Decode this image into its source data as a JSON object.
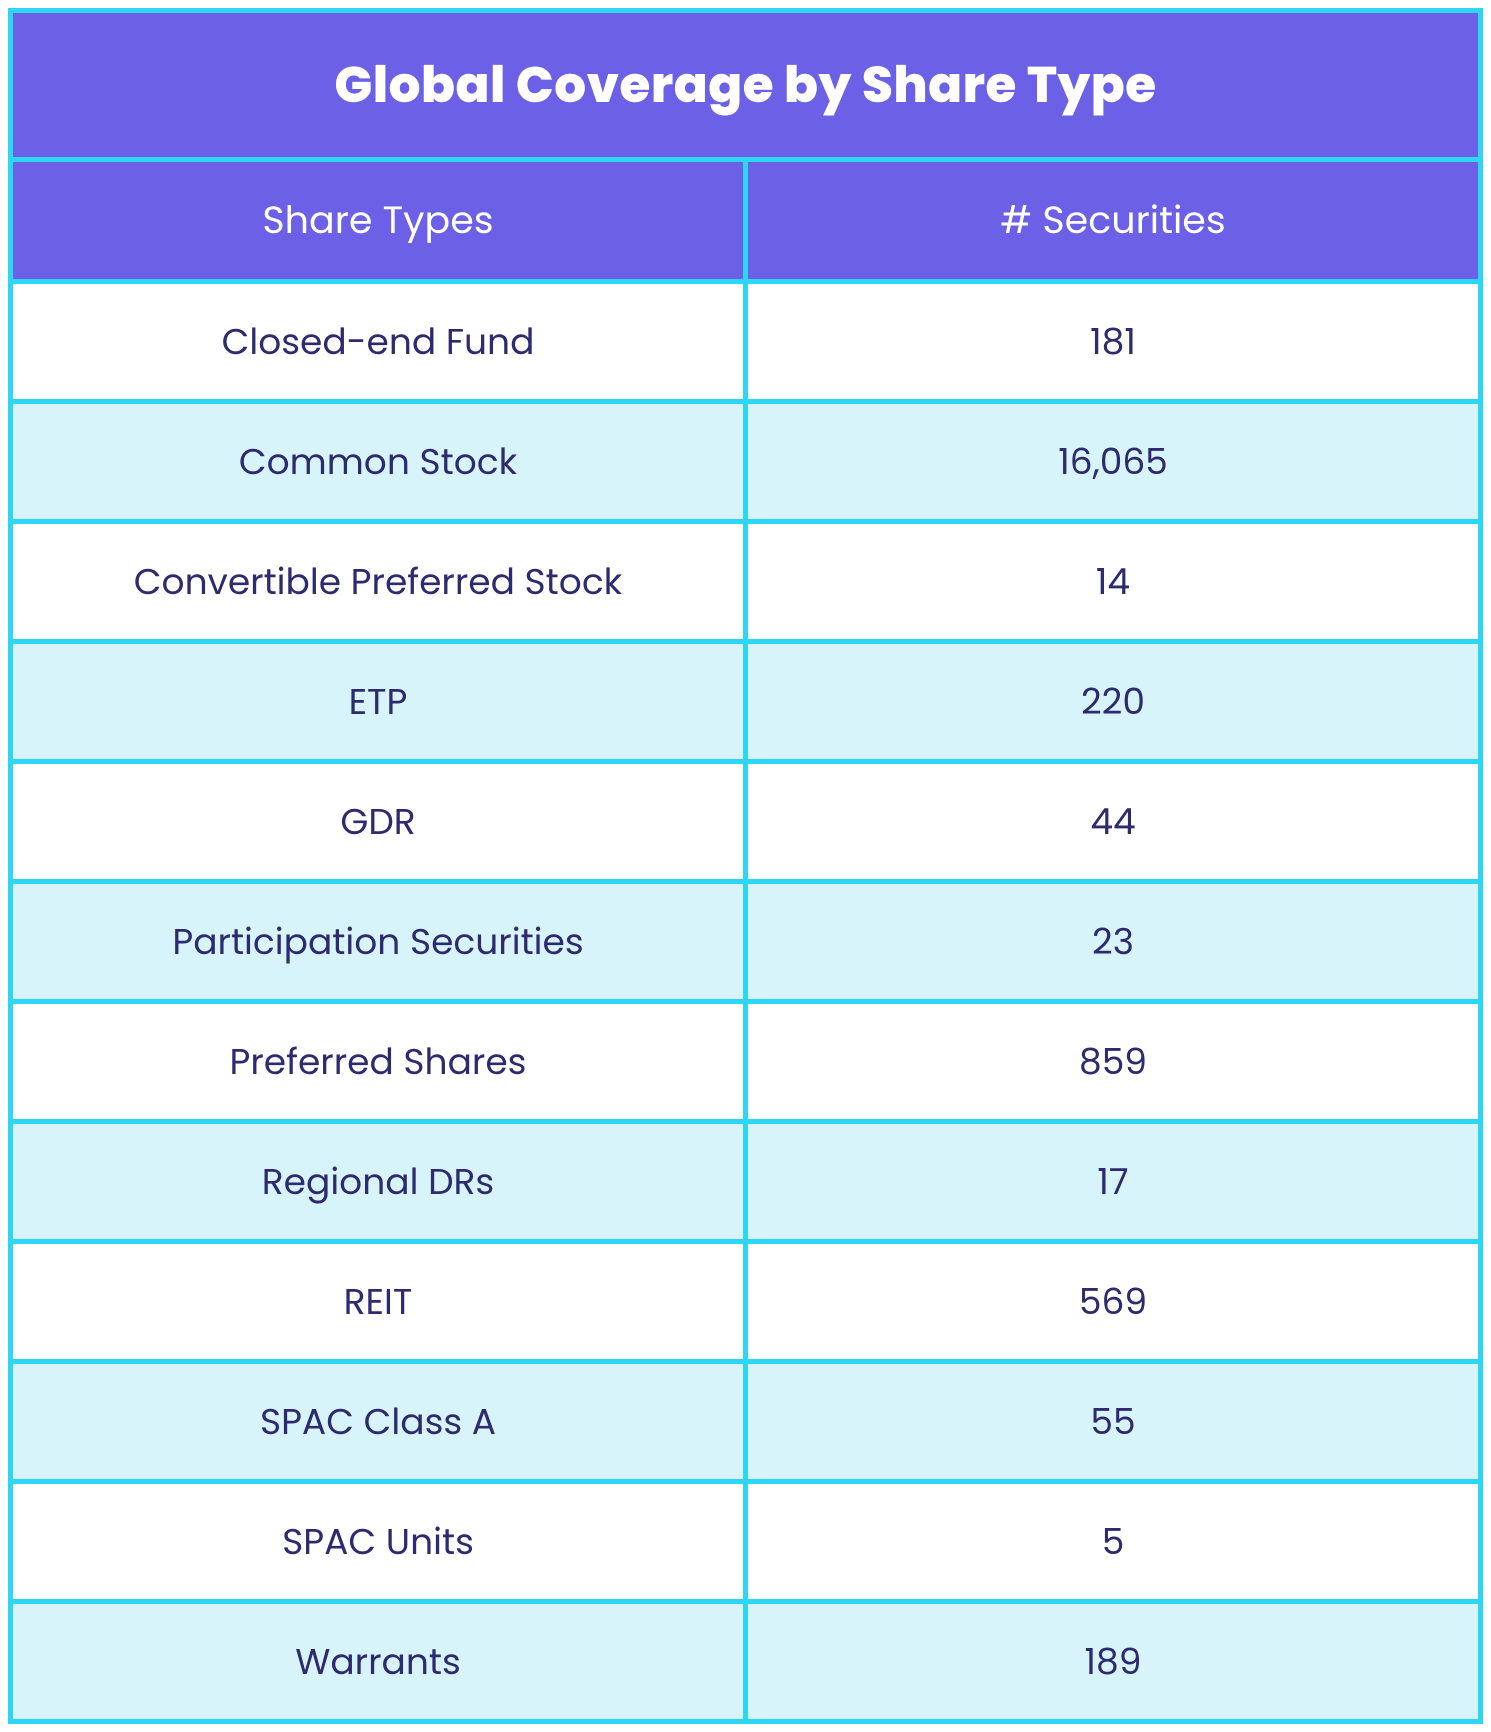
{
  "chart_data": {
    "type": "table",
    "title": "Global Coverage by Share Type",
    "columns": [
      "Share Types",
      "# Securities"
    ],
    "rows": [
      {
        "label": "Closed-end Fund",
        "value": "181"
      },
      {
        "label": "Common Stock",
        "value": "16,065"
      },
      {
        "label": "Convertible Preferred Stock",
        "value": "14"
      },
      {
        "label": "ETP",
        "value": "220"
      },
      {
        "label": "GDR",
        "value": "44"
      },
      {
        "label": "Participation Securities",
        "value": "23"
      },
      {
        "label": "Preferred Shares",
        "value": "859"
      },
      {
        "label": "Regional DRs",
        "value": "17"
      },
      {
        "label": "REIT",
        "value": "569"
      },
      {
        "label": "SPAC Class A",
        "value": "55"
      },
      {
        "label": "SPAC Units",
        "value": "5"
      },
      {
        "label": "Warrants",
        "value": "189"
      }
    ]
  }
}
